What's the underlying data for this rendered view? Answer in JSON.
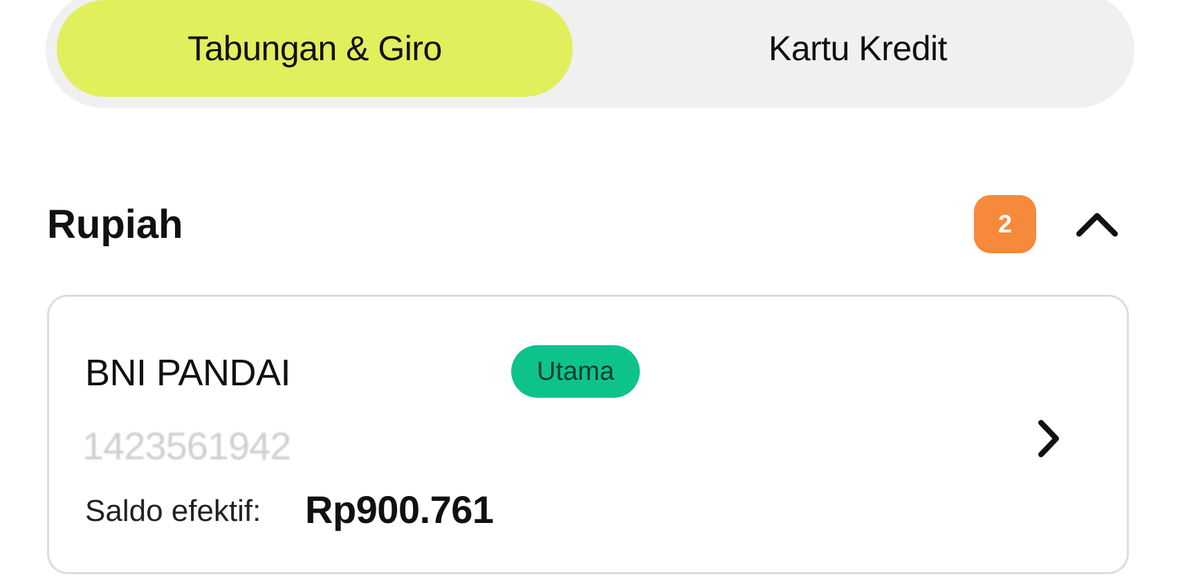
{
  "tabs": [
    {
      "label": "Tabungan & Giro",
      "active": true
    },
    {
      "label": "Kartu Kredit",
      "active": false
    }
  ],
  "section": {
    "title": "Rupiah",
    "count": "2",
    "toggle_icon": "chevron-up-icon"
  },
  "account": {
    "name": "BNI PANDAI",
    "badge": "Utama",
    "number": "1423561942",
    "balance_label": "Saldo efektif:",
    "balance_value": "Rp900.761",
    "open_icon": "chevron-right-icon"
  },
  "colors": {
    "active_tab": "#e1ef5c",
    "tab_track": "#f0f0f0",
    "count_badge": "#f6893a",
    "primary_badge": "#0ec38b",
    "card_border": "#dcdcdc"
  }
}
